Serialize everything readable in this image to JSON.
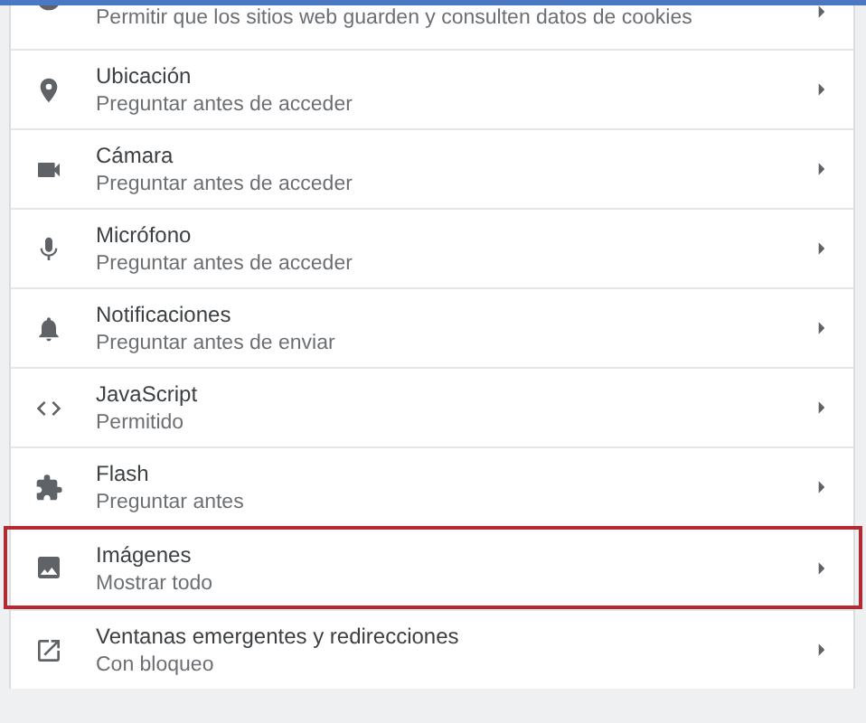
{
  "rows": [
    {
      "kind": "cookie",
      "subtitle": "Permitir que los sitios web guarden y consulten datos de cookies",
      "highlighted": false
    },
    {
      "kind": "location",
      "title": "Ubicación",
      "subtitle": "Preguntar antes de acceder",
      "highlighted": false
    },
    {
      "kind": "camera",
      "title": "Cámara",
      "subtitle": "Preguntar antes de acceder",
      "highlighted": false
    },
    {
      "kind": "microphone",
      "title": "Micrófono",
      "subtitle": "Preguntar antes de acceder",
      "highlighted": false
    },
    {
      "kind": "bell",
      "title": "Notificaciones",
      "subtitle": "Preguntar antes de enviar",
      "highlighted": false
    },
    {
      "kind": "code",
      "title": "JavaScript",
      "subtitle": "Permitido",
      "highlighted": false
    },
    {
      "kind": "puzzle",
      "title": "Flash",
      "subtitle": "Preguntar antes",
      "highlighted": false
    },
    {
      "kind": "image",
      "title": "Imágenes",
      "subtitle": "Mostrar todo",
      "highlighted": true
    },
    {
      "kind": "popup",
      "title": "Ventanas emergentes y redirecciones",
      "subtitle": "Con bloqueo",
      "highlighted": false
    }
  ]
}
